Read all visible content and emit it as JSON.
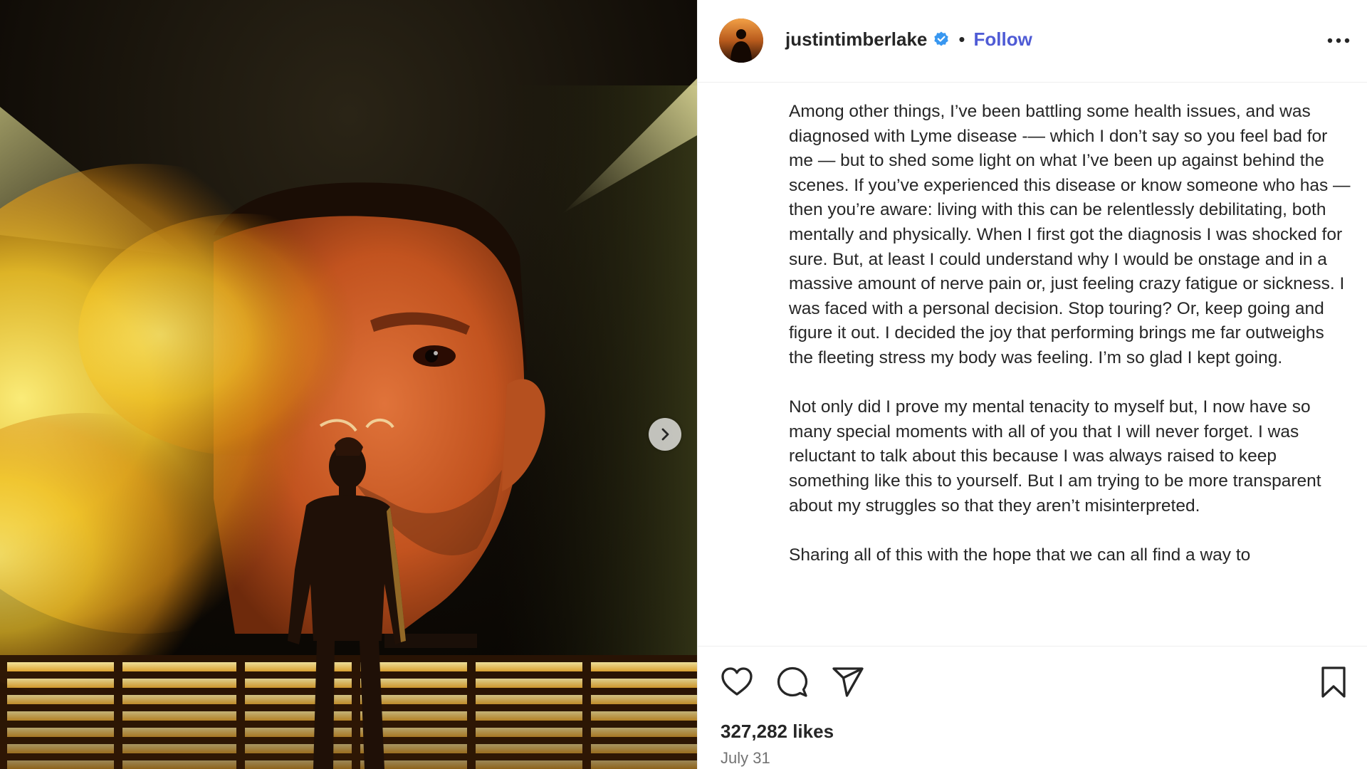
{
  "media": {
    "alt_icon": "photo",
    "next_icon": "chevron-right-icon"
  },
  "header": {
    "username": "justintimberlake",
    "verified_icon": "verified-badge-icon",
    "separator": "•",
    "follow_label": "Follow",
    "more_icon": "more-horizontal-icon"
  },
  "caption": {
    "paragraphs": [
      "Among other things, I’ve been battling some health issues, and was diagnosed with Lyme disease -— which I don’t say so you feel bad for me — but to shed some light on what I’ve been up against behind the scenes. If you’ve experienced this disease or know someone who has — then you’re aware: living with this can be relentlessly debilitating, both mentally and physically. When I first got the diagnosis I was shocked for sure. But, at least I could understand why I would be onstage and in a massive amount of nerve pain or, just feeling crazy fatigue or sickness. I was faced with a personal decision. Stop touring? Or, keep going and figure it out. I decided the joy that performing brings me far outweighs the fleeting stress my body was feeling. I’m so glad I kept going.",
      "Not only did I prove my mental tenacity to myself but, I now have so many special moments with all of you that I will never forget. I was reluctant to talk about this because I was always raised to keep something like this to yourself. But I am trying to be more transparent about my struggles so that they aren’t misinterpreted.",
      "Sharing all of this with the hope that we can all find a way to"
    ]
  },
  "actions": {
    "like_icon": "heart-icon",
    "comment_icon": "comment-icon",
    "share_icon": "share-icon",
    "save_icon": "bookmark-icon"
  },
  "stats": {
    "likes": "327,282 likes",
    "date": "July 31"
  },
  "colors": {
    "follow": "#4f5bd5",
    "verified": "#3897f0",
    "text": "#262626",
    "muted": "#737373"
  }
}
